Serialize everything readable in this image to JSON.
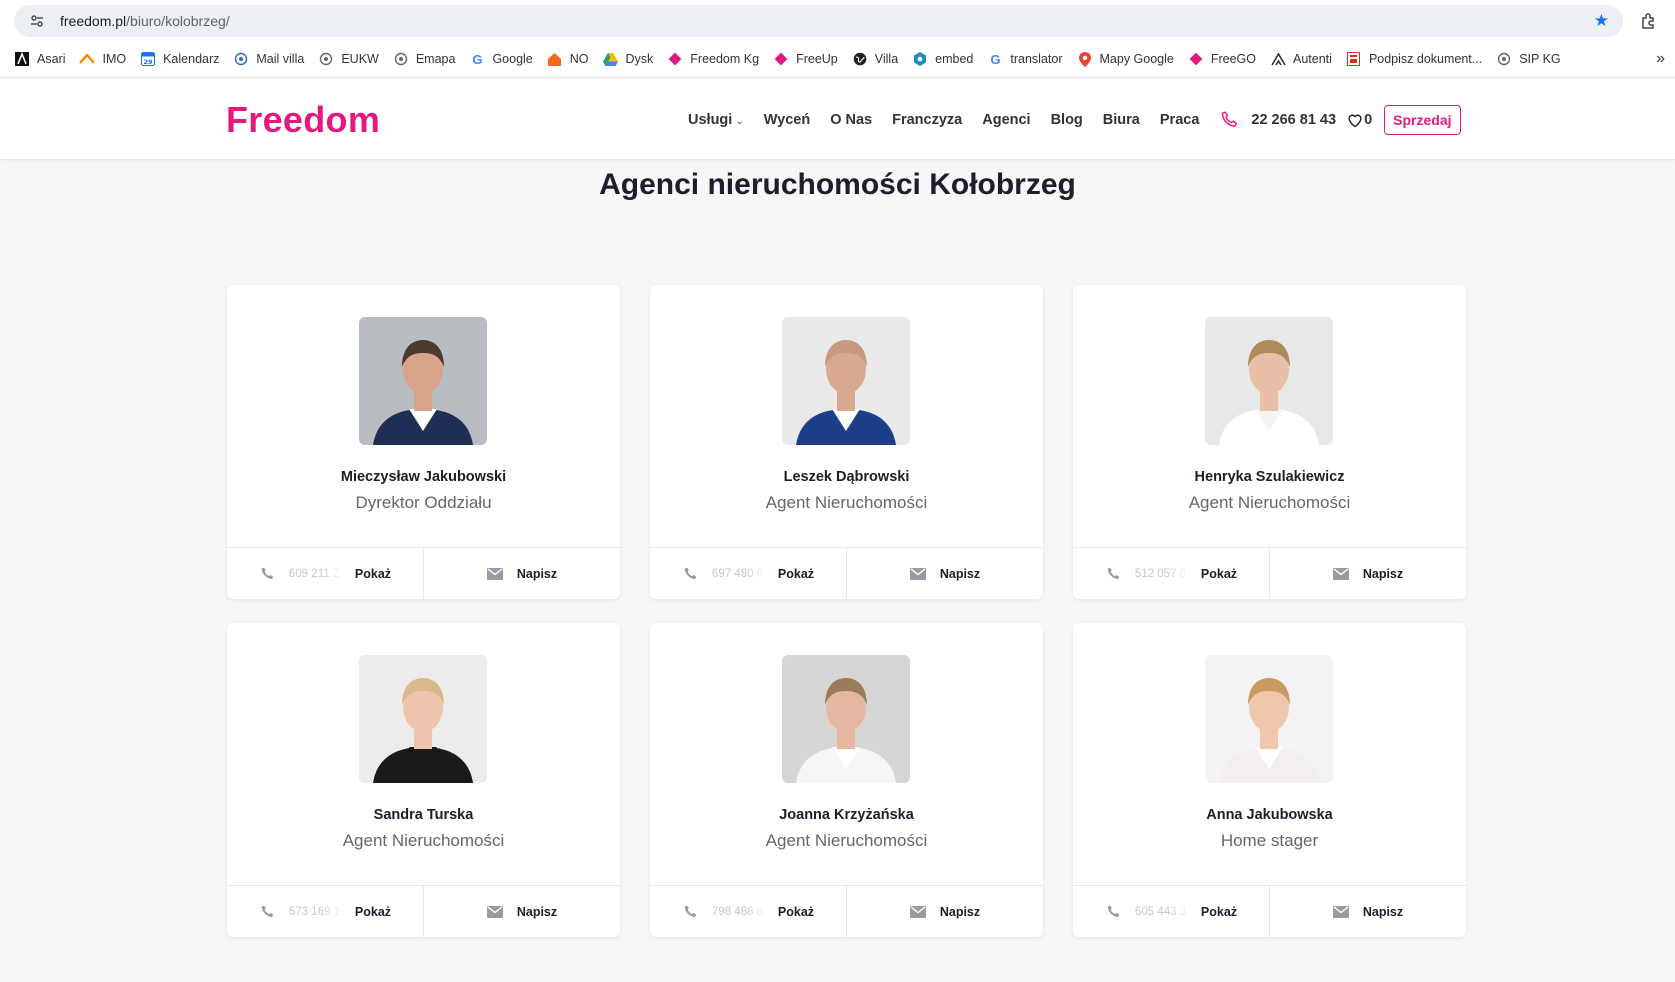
{
  "browser": {
    "url_host": "freedom.pl",
    "url_path": "/biuro/kolobrzeg/",
    "bookmarks": [
      {
        "label": "Asari",
        "icon": "asari-icon",
        "color": "#111111"
      },
      {
        "label": "IMO",
        "icon": "imo-icon",
        "color": "#f08c00"
      },
      {
        "label": "Kalendarz",
        "icon": "calendar-icon",
        "color": "#1a73e8"
      },
      {
        "label": "Mail villa",
        "icon": "mail-villa-icon",
        "color": "#2b6cb0"
      },
      {
        "label": "EUKW",
        "icon": "eukw-icon",
        "color": "#666666"
      },
      {
        "label": "Emapa",
        "icon": "emapa-icon",
        "color": "#666666"
      },
      {
        "label": "Google",
        "icon": "google-icon",
        "color": "#4285f4"
      },
      {
        "label": "NO",
        "icon": "home-icon",
        "color": "#f26b1d"
      },
      {
        "label": "Dysk",
        "icon": "drive-icon",
        "color": "#1fa463"
      },
      {
        "label": "Freedom Kg",
        "icon": "freedom-icon",
        "color": "#e5197d"
      },
      {
        "label": "FreeUp",
        "icon": "freedom-icon",
        "color": "#e5197d"
      },
      {
        "label": "Villa",
        "icon": "globe-icon",
        "color": "#222222"
      },
      {
        "label": "embed",
        "icon": "embed-icon",
        "color": "#1b8fc2"
      },
      {
        "label": "translator",
        "icon": "google-icon",
        "color": "#4285f4"
      },
      {
        "label": "Mapy Google",
        "icon": "maps-icon",
        "color": "#34a853"
      },
      {
        "label": "FreeGO",
        "icon": "freedom-icon",
        "color": "#e5197d"
      },
      {
        "label": "Autenti",
        "icon": "autenti-icon",
        "color": "#333333"
      },
      {
        "label": "Podpisz dokument...",
        "icon": "sign-icon",
        "color": "#d93025"
      },
      {
        "label": "SIP KG",
        "icon": "sip-icon",
        "color": "#666666"
      }
    ]
  },
  "header": {
    "logo": "Freedom",
    "nav": [
      "Usługi",
      "Wyceń",
      "O Nas",
      "Franczyza",
      "Agenci",
      "Blog",
      "Biura",
      "Praca"
    ],
    "phone": "22 266 81 43",
    "favorites_count": "0",
    "sell_label": "Sprzedaj"
  },
  "page": {
    "title": "Agenci nieruchomości Kołobrzeg",
    "show_label": "Pokaż",
    "write_label": "Napisz"
  },
  "agents": [
    {
      "name": "Mieczysław Jakubowski",
      "role": "Dyrektor Oddziału",
      "phone_partial": "609 211 2",
      "portrait": {
        "bg": "#b9bcc0",
        "skin": "#d8a48a",
        "hair": "#4a3a30",
        "top": "#1e2f55",
        "shirt": "#ffffff"
      }
    },
    {
      "name": "Leszek Dąbrowski",
      "role": "Agent Nieruchomości",
      "phone_partial": "697 480 0",
      "portrait": {
        "bg": "#e9e9ea",
        "skin": "#d9a98f",
        "hair": "#c79a80",
        "top": "#1d3f8a",
        "shirt": "#ffffff"
      }
    },
    {
      "name": "Henryka Szulakiewicz",
      "role": "Agent Nieruchomości",
      "phone_partial": "512 057 0",
      "portrait": {
        "bg": "#e8e8e8",
        "skin": "#e8c0a8",
        "hair": "#b08a5a",
        "top": "#ffffff",
        "shirt": "#f4f4f4"
      }
    },
    {
      "name": "Sandra Turska",
      "role": "Agent Nieruchomości",
      "phone_partial": "573 169 1",
      "portrait": {
        "bg": "#ececec",
        "skin": "#eec4ad",
        "hair": "#d9b98c",
        "top": "#1a1a1a",
        "shirt": "#1a1a1a"
      }
    },
    {
      "name": "Joanna Krzyżańska",
      "role": "Agent Nieruchomości",
      "phone_partial": "798 488 8",
      "portrait": {
        "bg": "#d6d6d6",
        "skin": "#e6b7a0",
        "hair": "#9c7b5c",
        "top": "#f6f6f6",
        "shirt": "#ffffff"
      }
    },
    {
      "name": "Anna Jakubowska",
      "role": "Home stager",
      "phone_partial": "605 443 3",
      "portrait": {
        "bg": "#f3f3f3",
        "skin": "#efc7ad",
        "hair": "#c99b63",
        "top": "#f2eef2",
        "shirt": "#ffffff"
      }
    }
  ]
}
